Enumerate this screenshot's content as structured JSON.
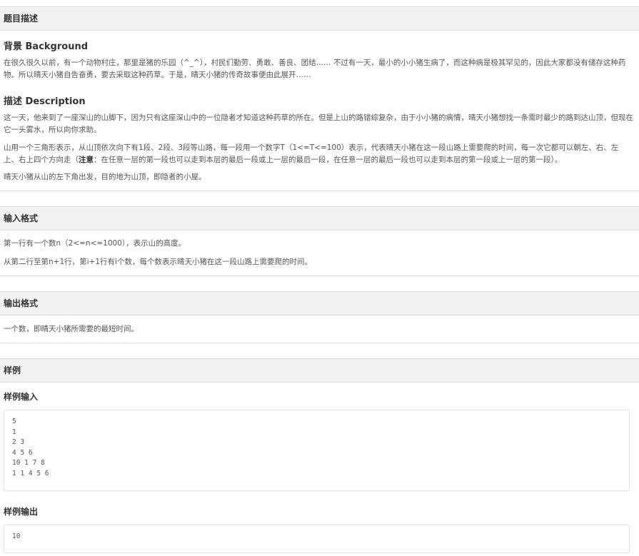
{
  "problem": {
    "title": "题目描述",
    "background": {
      "heading": "背景 Background",
      "text": "在很久很久以前，有一个动物村庄，那里是猪的乐园（^_^），村民们勤劳、勇敢、善良、团结…… 不过有一天，最小的小小猪生病了，而这种病是极其罕见的，因此大家都没有储存这种药物。所以晴天小猪自告奋勇，要去采取这种药草。于是，晴天小猪的传奇故事便由此展开……"
    },
    "description": {
      "heading": "描述 Description",
      "p1": "这一天，他来到了一座深山的山脚下，因为只有这座深山中的一位隐者才知道这种药草的所在。但是上山的路错综复杂，由于小小猪的病情，晴天小猪想找一条需时最少的路到达山顶，但现在它一头雾水，所以向你求助。",
      "p2_before": "山用一个三角形表示，从山顶依次向下有1段、2段、3段等山路，每一段用一个数字T（1<=T<=100）表示，代表晴天小猪在这一段山路上需要爬的时间，每一次它都可以朝左、右、左上、右上四个方向走（",
      "p2_bold": "注意",
      "p2_after": "：在任意一层的第一段也可以走到本层的最后一段或上一层的最后一段，在任意一层的最后一段也可以走到本层的第一段或上一层的第一段）。",
      "p3": "晴天小猪从山的左下角出发，目的地为山顶，即隐者的小屋。"
    }
  },
  "input_format": {
    "title": "输入格式",
    "line1": "第一行有一个数n（2<=n<=1000），表示山的高度。",
    "line2": "从第二行至第n+1行，第i+1行有i个数，每个数表示晴天小猪在这一段山路上需要爬的时间。"
  },
  "output_format": {
    "title": "输出格式",
    "line1": "一个数，即晴天小猪所需要的最短时间。"
  },
  "sample": {
    "title": "样例",
    "input_heading": "样例输入",
    "input": "5\n1\n2 3\n4 5 6\n10 1 7 8\n1 1 4 5 6",
    "output_heading": "样例输出",
    "output": "10"
  }
}
